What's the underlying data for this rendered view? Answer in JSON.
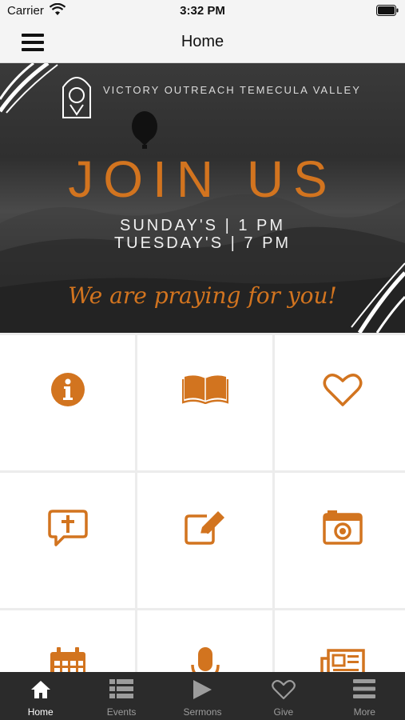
{
  "status_bar": {
    "carrier": "Carrier",
    "time": "3:32 PM"
  },
  "nav": {
    "title": "Home",
    "menu_icon": "hamburger-menu-icon"
  },
  "banner": {
    "org_name": "VICTORY OUTREACH TEMECULA VALLEY",
    "headline": "JOIN US",
    "schedule": [
      "SUNDAY'S | 1 PM",
      "TUESDAY'S | 7 PM"
    ],
    "tagline": "We are praying for you!",
    "accent_color": "#d2741f"
  },
  "grid": {
    "tiles": [
      {
        "icon": "info-icon"
      },
      {
        "icon": "open-book-icon"
      },
      {
        "icon": "heart-icon"
      },
      {
        "icon": "prayer-chat-icon"
      },
      {
        "icon": "edit-note-icon"
      },
      {
        "icon": "camera-icon"
      },
      {
        "icon": "calendar-icon"
      },
      {
        "icon": "microphone-icon"
      },
      {
        "icon": "newspaper-icon"
      }
    ],
    "icon_color": "#d2741f"
  },
  "tab_bar": {
    "tabs": [
      {
        "label": "Home",
        "icon": "home-icon",
        "active": true
      },
      {
        "label": "Events",
        "icon": "list-icon",
        "active": false
      },
      {
        "label": "Sermons",
        "icon": "play-icon",
        "active": false
      },
      {
        "label": "Give",
        "icon": "heart-outline-icon",
        "active": false
      },
      {
        "label": "More",
        "icon": "more-menu-icon",
        "active": false
      }
    ]
  }
}
